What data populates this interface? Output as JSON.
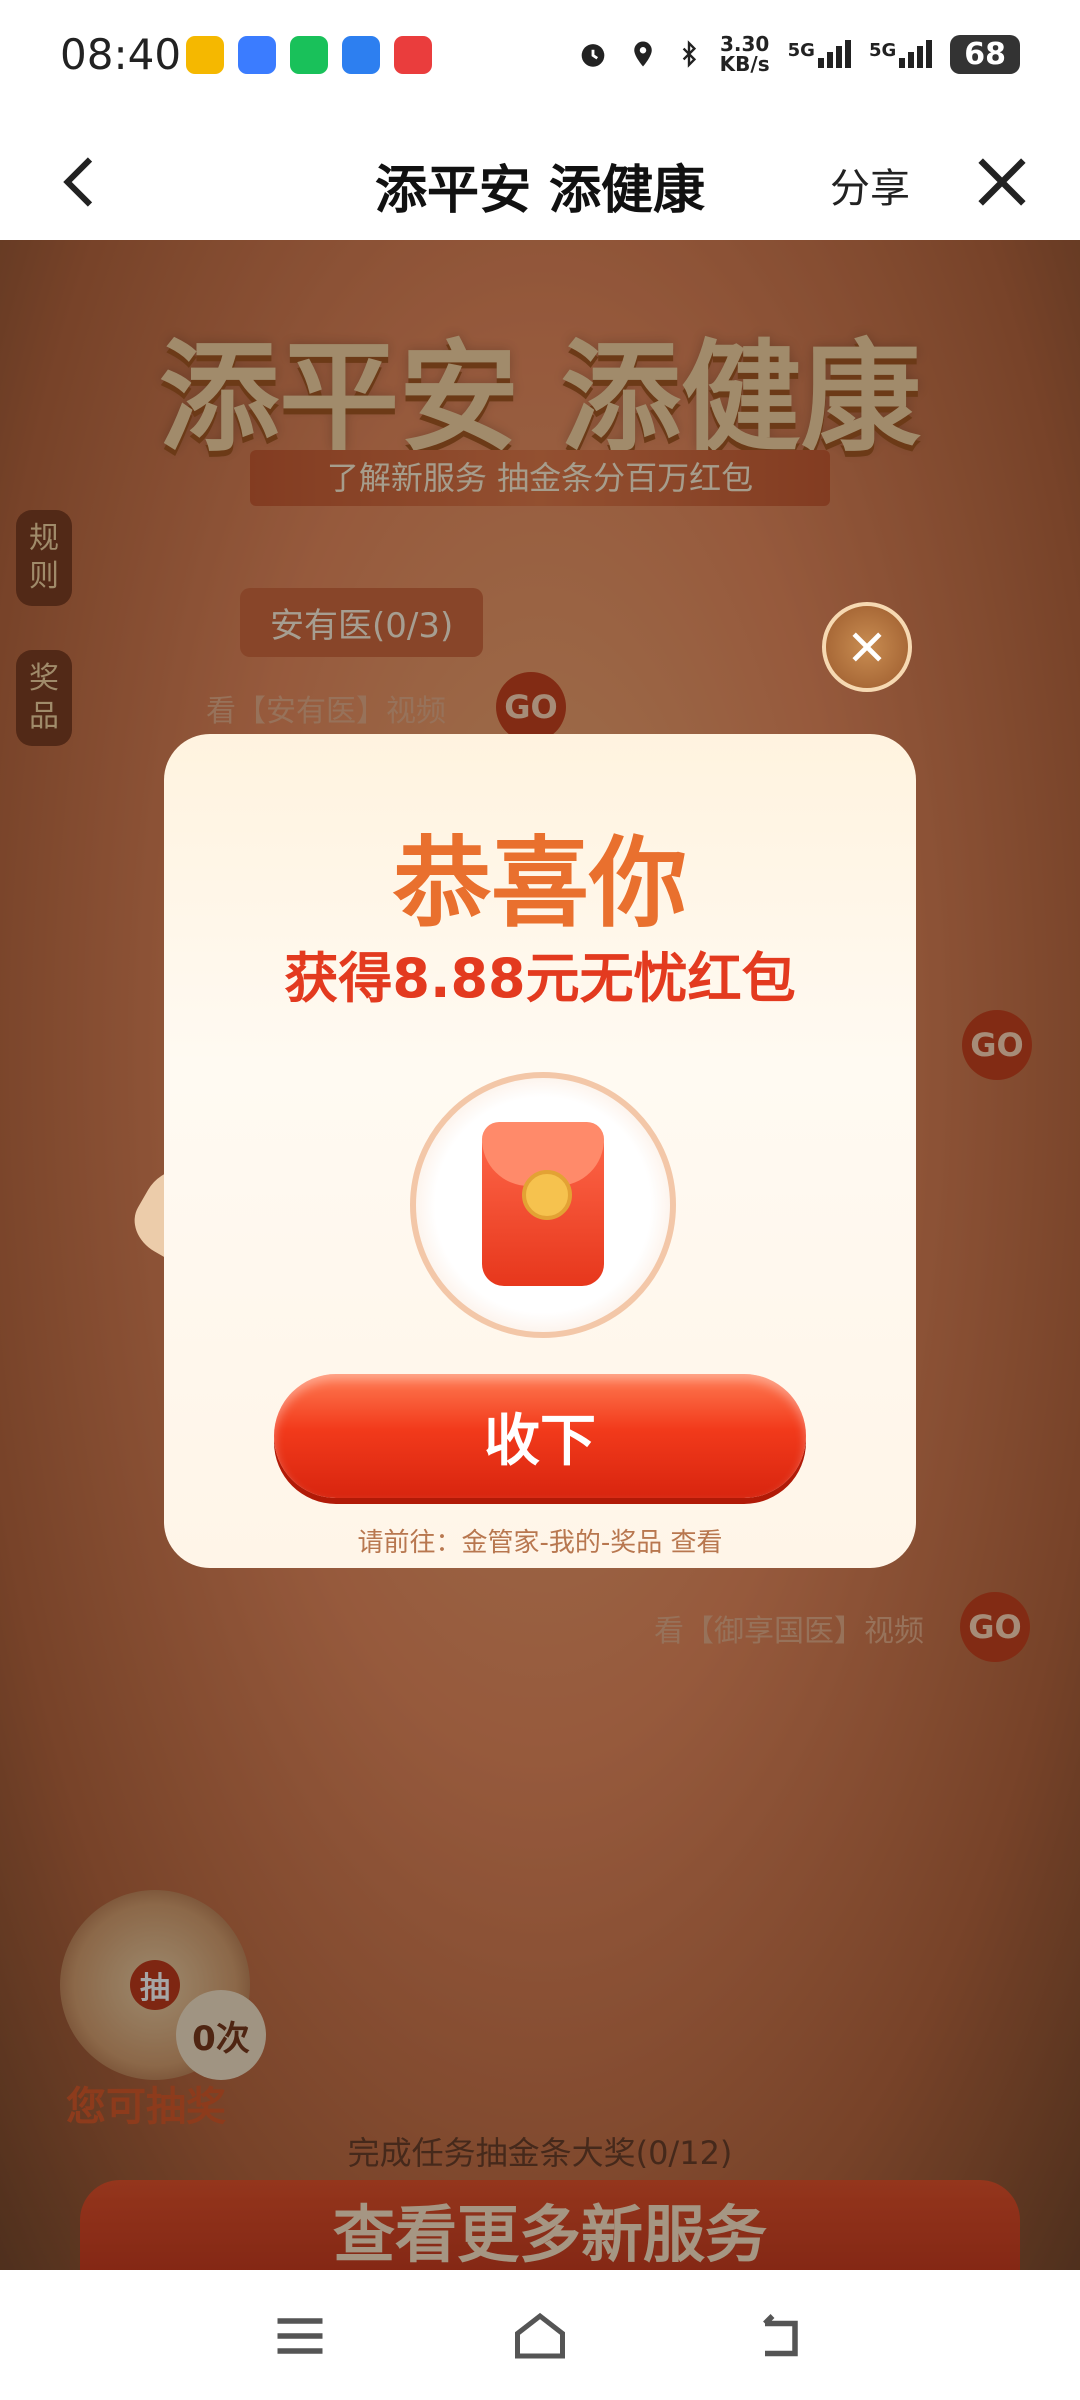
{
  "status_bar": {
    "time": "08:40",
    "network_speed": "3.30",
    "network_speed_unit": "KB/s",
    "signal_1": "5G",
    "signal_2": "5G",
    "battery": "68"
  },
  "nav": {
    "title": "添平安 添健康",
    "share_label": "分享"
  },
  "page": {
    "hero_title": "添平安 添健康",
    "hero_subtitle": "了解新服务 抽金条分百万红包",
    "side_tabs": [
      "规则",
      "奖品"
    ],
    "task_tab": "安有医(0/3)",
    "task_line_1": "看【安有医】视频",
    "task_line_2": "看【御享国医】视频",
    "go_label": "GO",
    "lottery_button": "抽",
    "lottery_count": "0次",
    "lottery_label": "您可抽奖",
    "progress_text": "完成任务抽金条大奖(0/12)",
    "more_banner": "查看更多新服务"
  },
  "modal": {
    "title": "恭喜你",
    "subtitle": "获得8.88元无忧红包",
    "accept_label": "收下",
    "hint": "请前往：金管家-我的-奖品 查看"
  },
  "colors": {
    "accent": "#e33a1f",
    "title_orange": "#e9702e",
    "modal_bg": "#fff3df"
  }
}
